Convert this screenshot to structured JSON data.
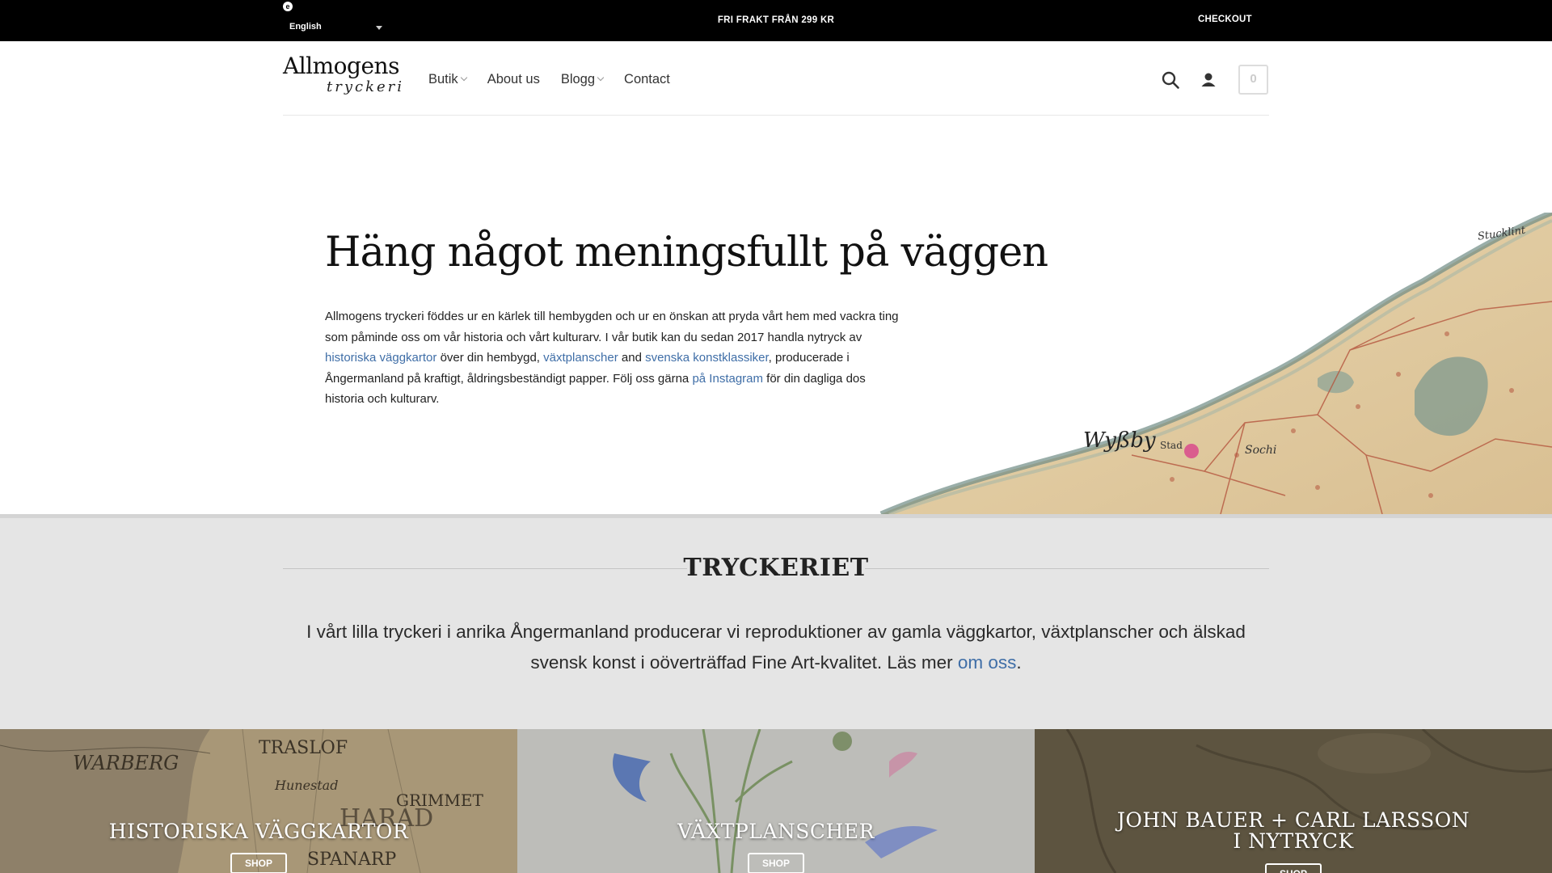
{
  "topbar": {
    "language": "English",
    "promo": "FRI FRAKT FRÅN 299 KR",
    "checkout": "CHECKOUT"
  },
  "header": {
    "logo_main": "Allmogens",
    "logo_sub": "tryckeri",
    "nav": [
      {
        "label": "Butik",
        "has_dropdown": true
      },
      {
        "label": "About us",
        "has_dropdown": false
      },
      {
        "label": "Blogg",
        "has_dropdown": true
      },
      {
        "label": "Contact",
        "has_dropdown": false
      }
    ],
    "icons": [
      "search-icon",
      "account-icon",
      "cart-icon"
    ],
    "cart_count": "0"
  },
  "hero": {
    "title": "Häng något meningsfullt på väggen",
    "text_1": "Allmogens tryckeri föddes ur en kärlek till hembygden och ur en önskan att pryda vårt hem med vackra ting som påminde oss om vår historia och vårt kulturarv. I vår butik kan du sedan 2017 handla nytryck av ",
    "link_1": "historiska väggkartor",
    "text_2": " över din hembygd, ",
    "link_2": "växtplanscher",
    "text_3": " and ",
    "link_3": "svenska konstklassiker",
    "text_4": ", producerade i Ångermanland på kraftigt, åldringsbeständigt papper. Följ oss gärna ",
    "link_4": "på Instagram",
    "text_5": " för din dagliga dos historia och kulturarv.",
    "map_labels": [
      "Wyßby",
      "Stad",
      "Sochi",
      "Stucklint"
    ]
  },
  "tryckeriet": {
    "title": "TRYCKERIET",
    "text": "I vårt lilla tryckeri i anrika Ångermanland producerar vi reproduktioner av gamla väggkartor, växtplanscher och älskad svensk konst i oöverträffad Fine Art-kvalitet. Läs mer ",
    "link": "om oss",
    "text_end": "."
  },
  "tiles": [
    {
      "title": "HISTORISKA VÄGGKARTOR",
      "button": "SHOP",
      "map_words": [
        "WARBERG",
        "TRASLOF",
        "Hunestad",
        "GRIMMET",
        "HARAD",
        "SPANARP"
      ]
    },
    {
      "title": "VÄXTPLANSCHER",
      "button": "SHOP"
    },
    {
      "title_line1": "JOHN BAUER + CARL LARSSON",
      "title_line2": "I NYTRYCK",
      "button": "SHOP"
    }
  ],
  "colors": {
    "link": "#3f6ea7",
    "topbar_bg": "#000000",
    "band_bg": "#e5e5e5"
  }
}
